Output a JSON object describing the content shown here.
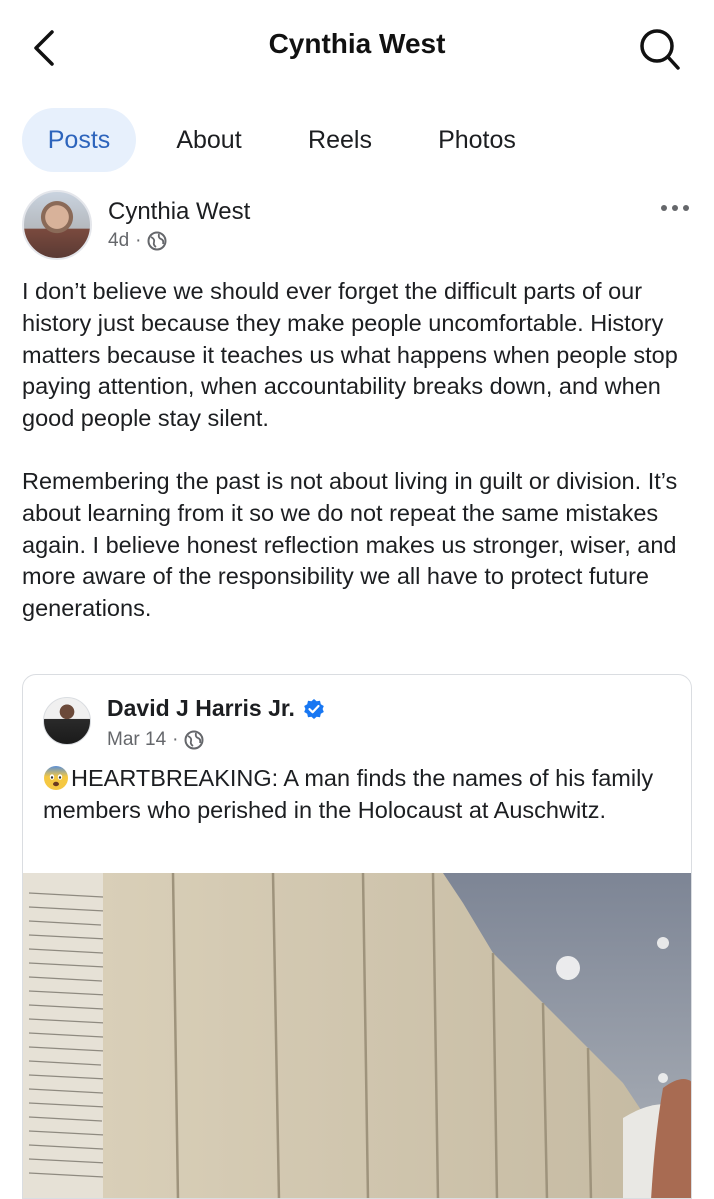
{
  "header": {
    "title": "Cynthia West",
    "back_icon": "chevron-left-icon",
    "search_icon": "search-icon"
  },
  "tabs": [
    {
      "label": "Posts",
      "active": true
    },
    {
      "label": "About",
      "active": false
    },
    {
      "label": "Reels",
      "active": false
    },
    {
      "label": "Photos",
      "active": false
    }
  ],
  "post": {
    "author": "Cynthia West",
    "time": "4d",
    "separator": "·",
    "audience_icon": "globe-icon",
    "more_icon": "more-dots-icon",
    "paragraphs": [
      "I don’t believe we should ever forget the difficult parts of our history just because they make people uncomfortable. History matters because it teaches us what happens when people stop paying attention, when accountability breaks down, and when good people stay silent.",
      "Remembering the past is not about living in guilt or division. It’s about learning from it so we do not repeat the same mistakes again. I believe honest reflection makes us stronger, wiser, and more aware of the responsibility we all have to protect future generations."
    ]
  },
  "shared_post": {
    "author": "David J Harris Jr.",
    "verified_icon": "verified-badge-icon",
    "time": "Mar 14",
    "separator": "·",
    "audience_icon": "globe-icon",
    "emoji_icon": "fearful-face-emoji",
    "text": "HEARTBREAKING: A man finds the names of his family members who perished in the Holocaust at Auschwitz.",
    "accent_color": "#1877f2"
  }
}
